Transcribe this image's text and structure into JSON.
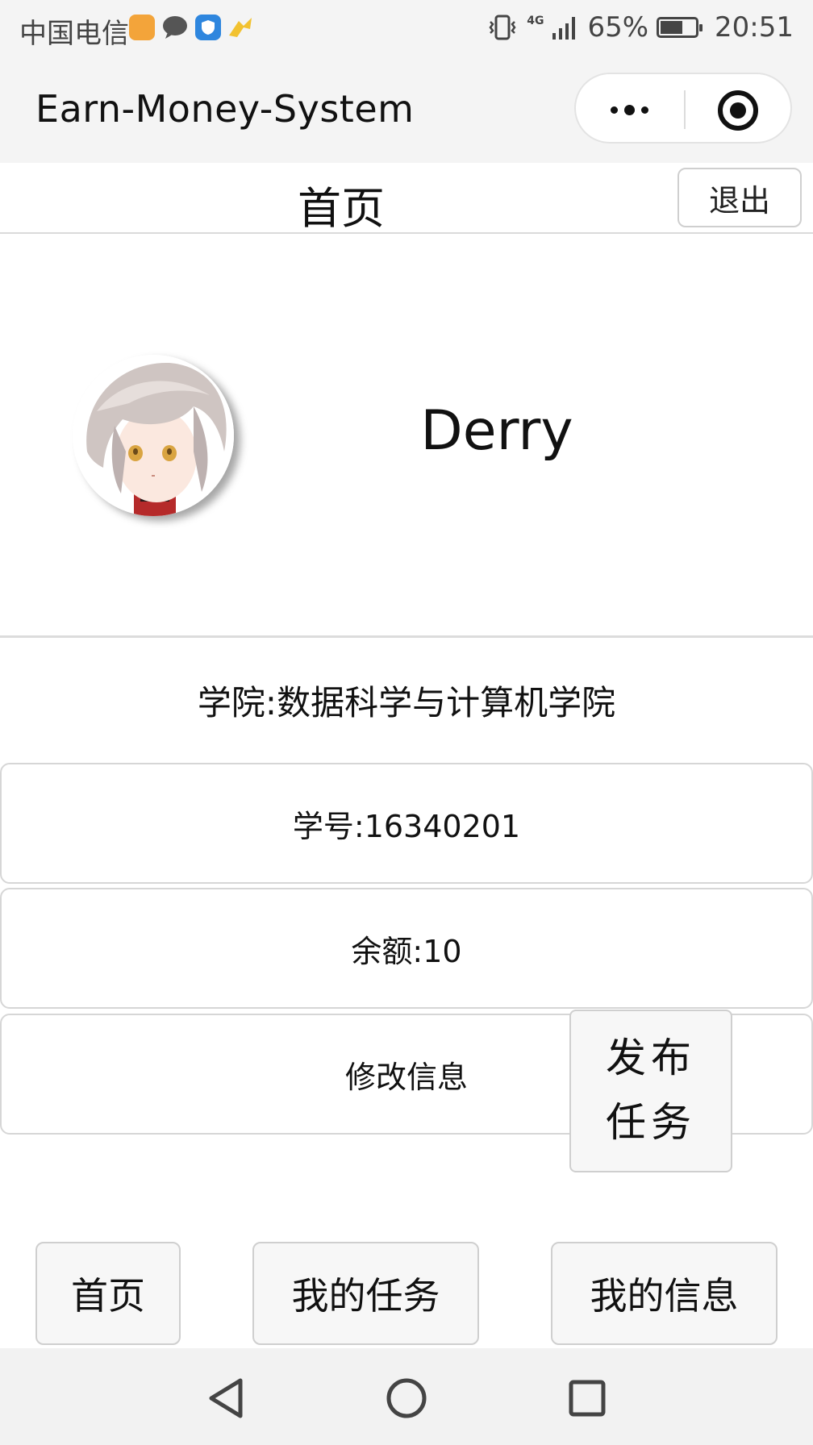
{
  "status_bar": {
    "carrier": "中国电信",
    "network": "4G",
    "battery_percent": "65%",
    "battery_level": 0.65,
    "time": "20:51",
    "notification_icons": [
      "app-badge-icon",
      "chat-bubble-icon",
      "shield-icon",
      "arrow-icon"
    ]
  },
  "nav": {
    "title": "Earn-Money-System"
  },
  "header": {
    "title": "首页",
    "logout_label": "退出"
  },
  "profile": {
    "username": "Derry",
    "college": "学院:数据科学与计算机学院"
  },
  "info_cards": [
    {
      "label": "学号:16340201"
    },
    {
      "label": "余额:10"
    },
    {
      "label": "修改信息"
    }
  ],
  "publish_button": {
    "line1": "发布",
    "line2": "任务"
  },
  "bottom_nav": {
    "home": "首页",
    "my_tasks": "我的任务",
    "my_info": "我的信息"
  },
  "colors": {
    "bar_bg": "#f4f4f4",
    "button_bg": "#f7f7f7",
    "border": "#cfcfcf"
  }
}
